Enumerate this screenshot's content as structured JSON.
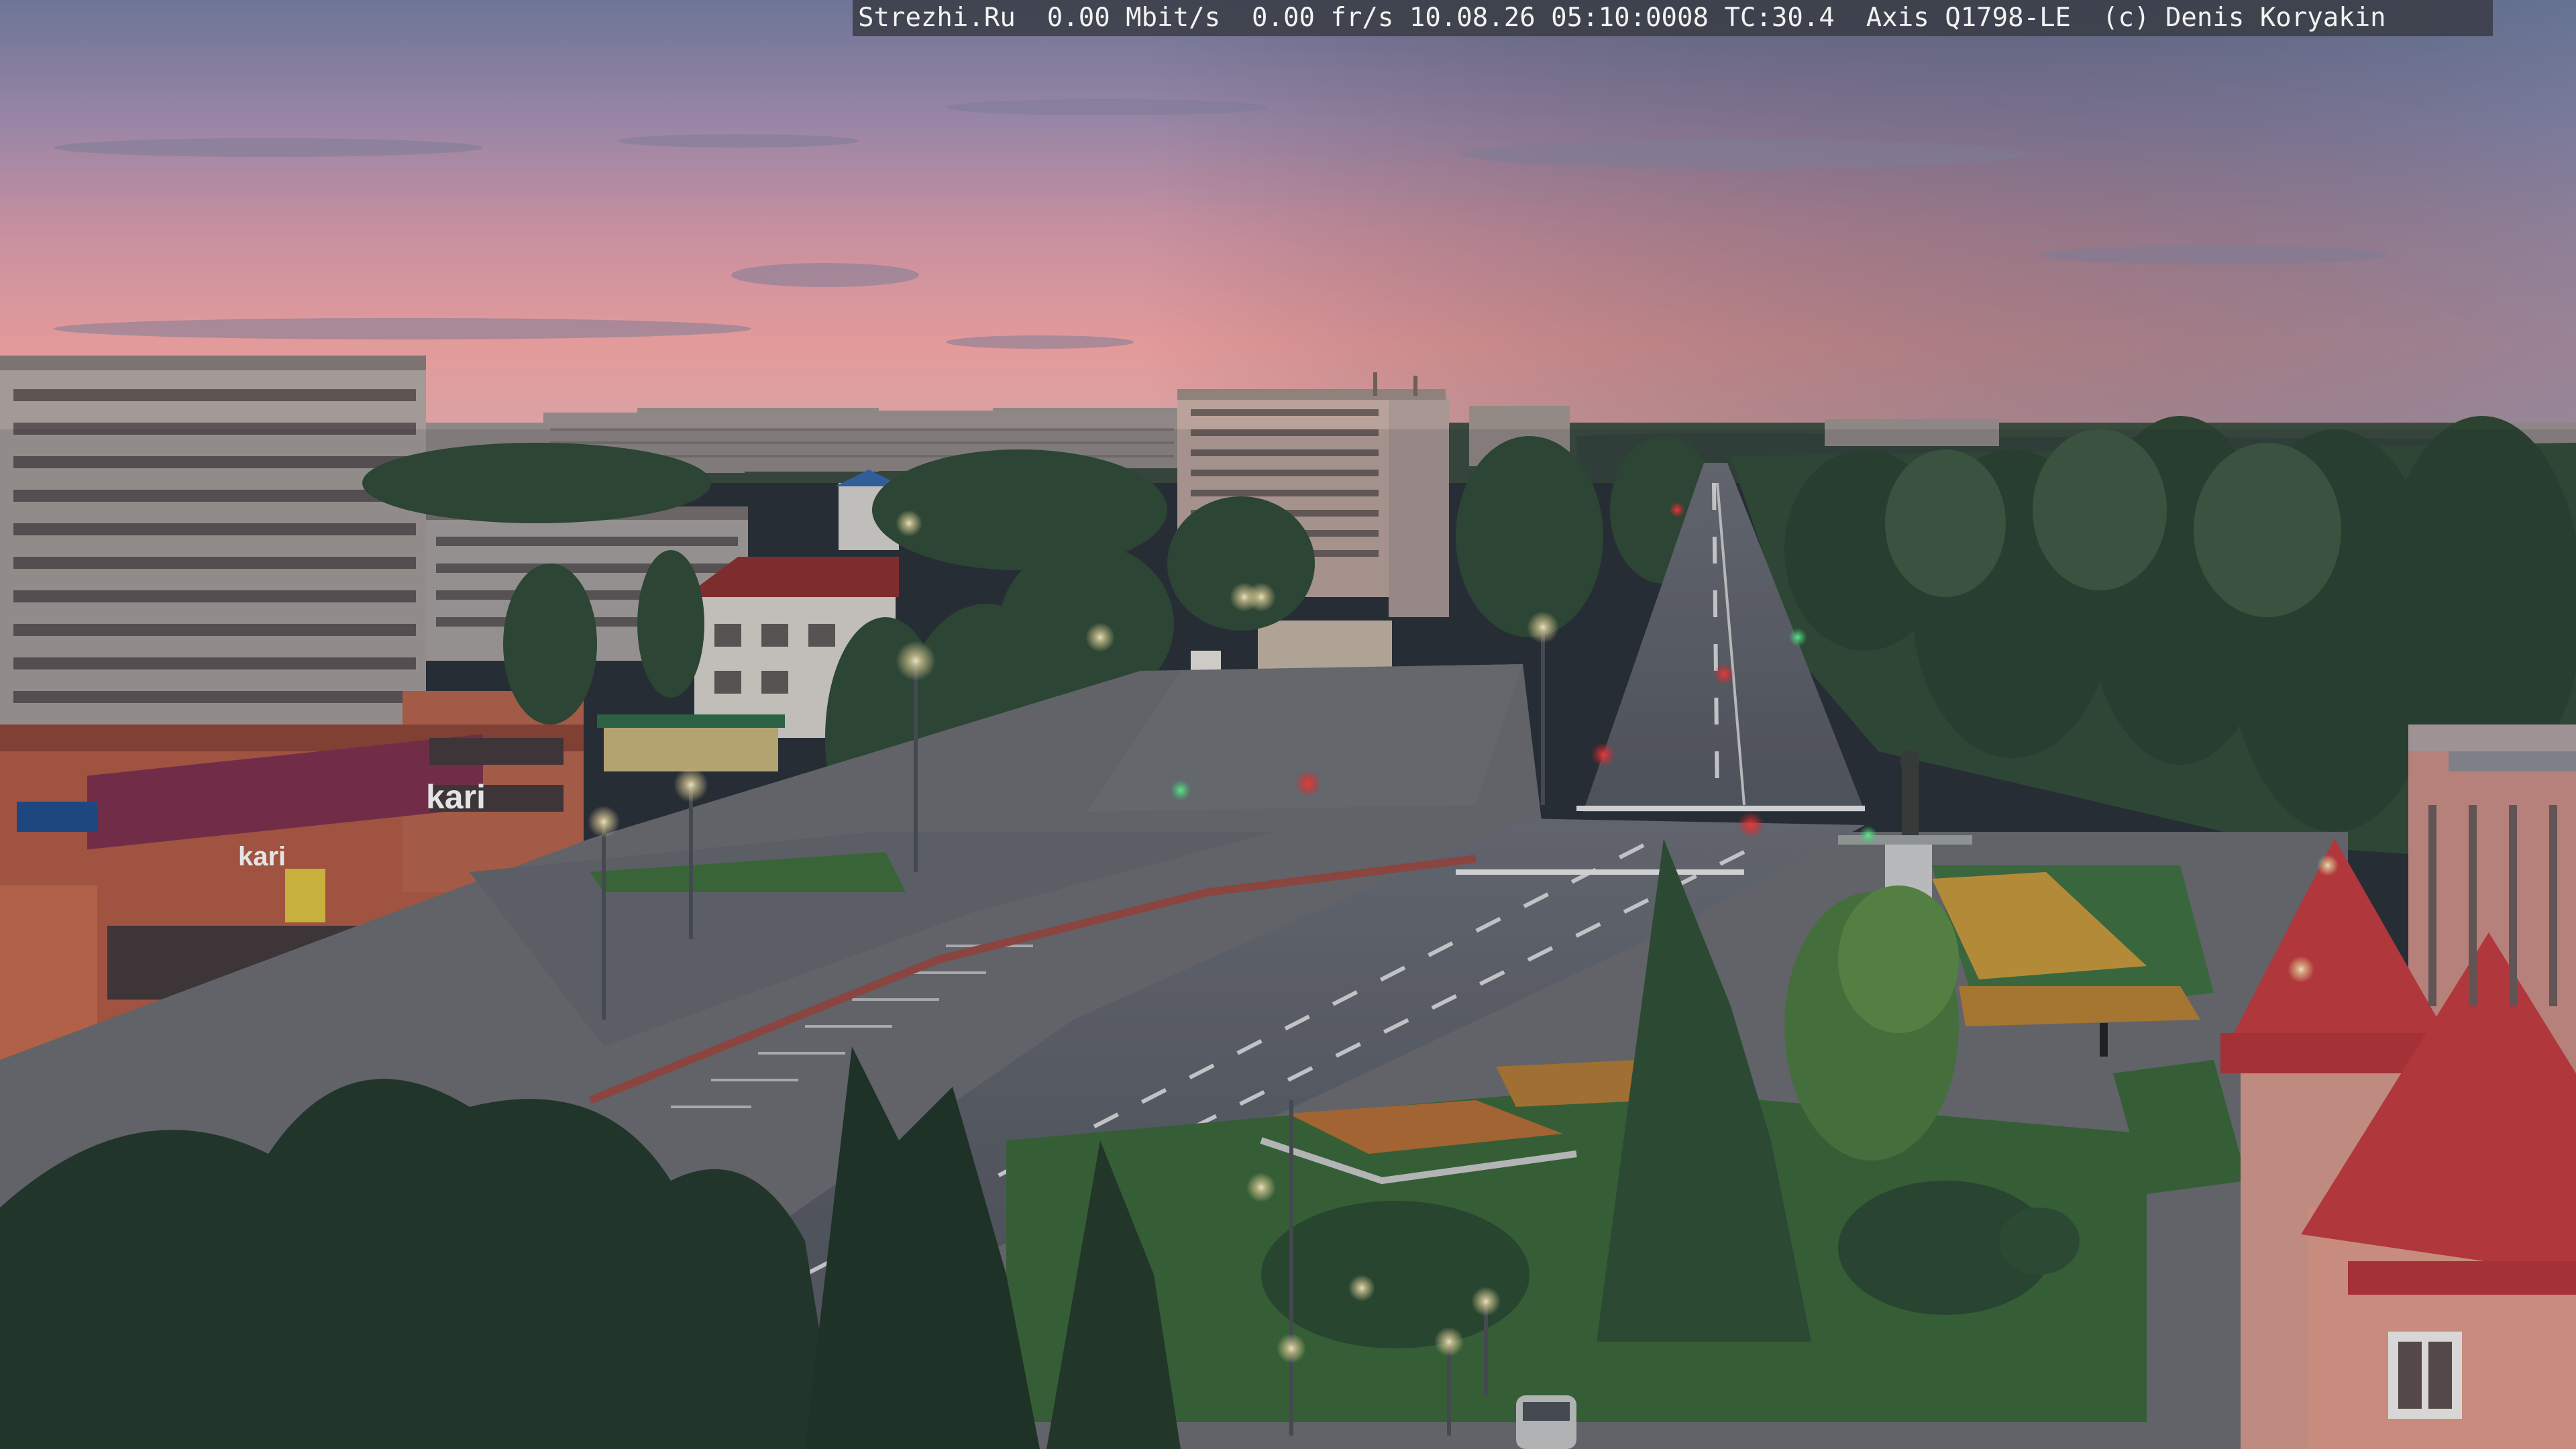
{
  "overlay": {
    "site": "Strezhi.Ru",
    "bitrate": "0.00 Mbit/s",
    "framerate": "0.00 fr/s",
    "datetime": "10.08.26 05:10:0008",
    "tc": "TC:30.4",
    "camera_model": "Axis Q1798-LE",
    "copyright": "(c) Denis Koryakin"
  },
  "store_signs": {
    "brand": "kari",
    "brand_second": "kari"
  }
}
